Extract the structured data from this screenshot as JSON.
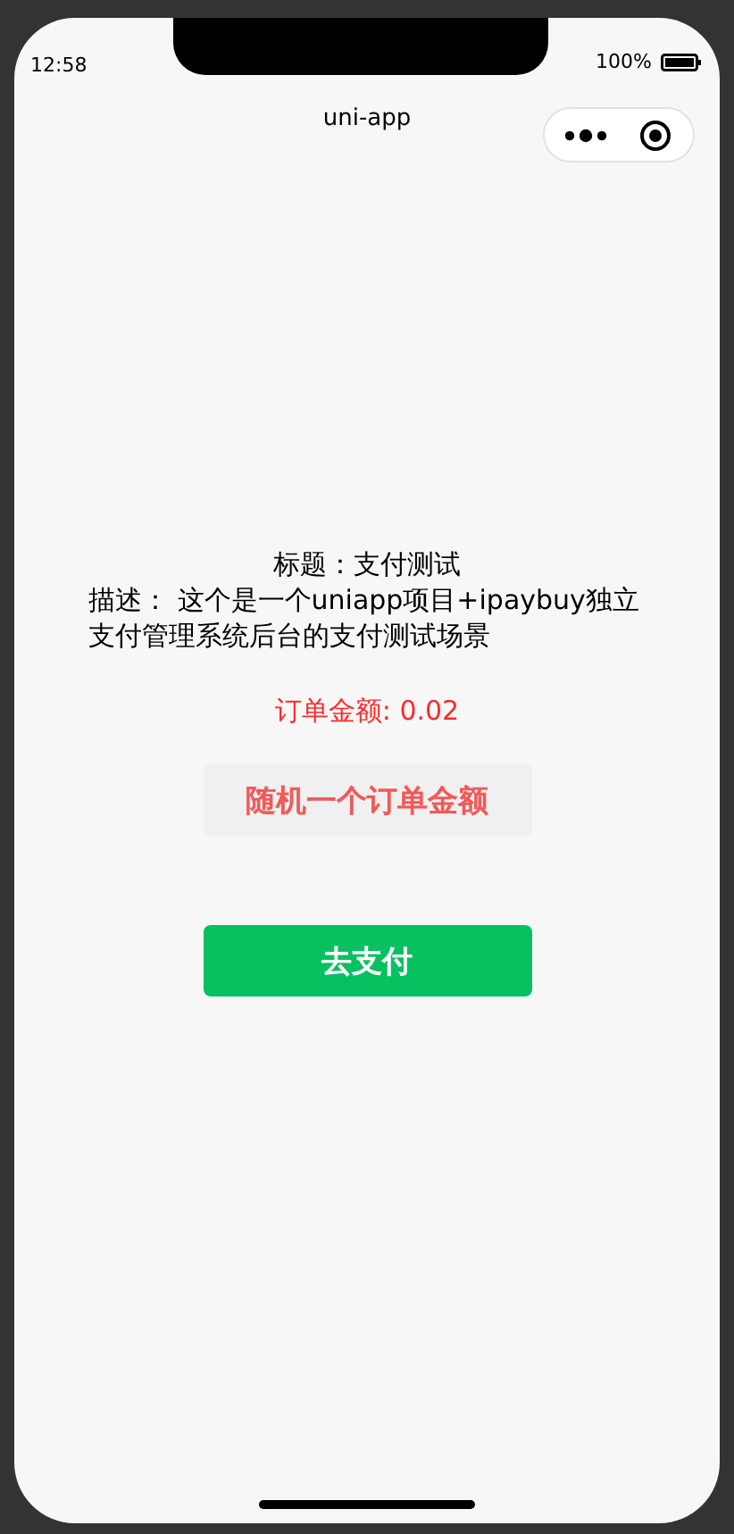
{
  "status_bar": {
    "time": "12:58",
    "battery": "100%"
  },
  "nav_bar": {
    "title": "uni-app"
  },
  "content": {
    "title": "标题：支付测试",
    "description": "描述： 这个是一个uniapp项目+ipaybuy独立支付管理系统后台的支付测试场景",
    "amount": "订单金额: 0.02"
  },
  "buttons": [
    {
      "label": "随机一个订单金额",
      "kind": "secondary"
    },
    {
      "label": "去支付",
      "kind": "primary"
    }
  ]
}
